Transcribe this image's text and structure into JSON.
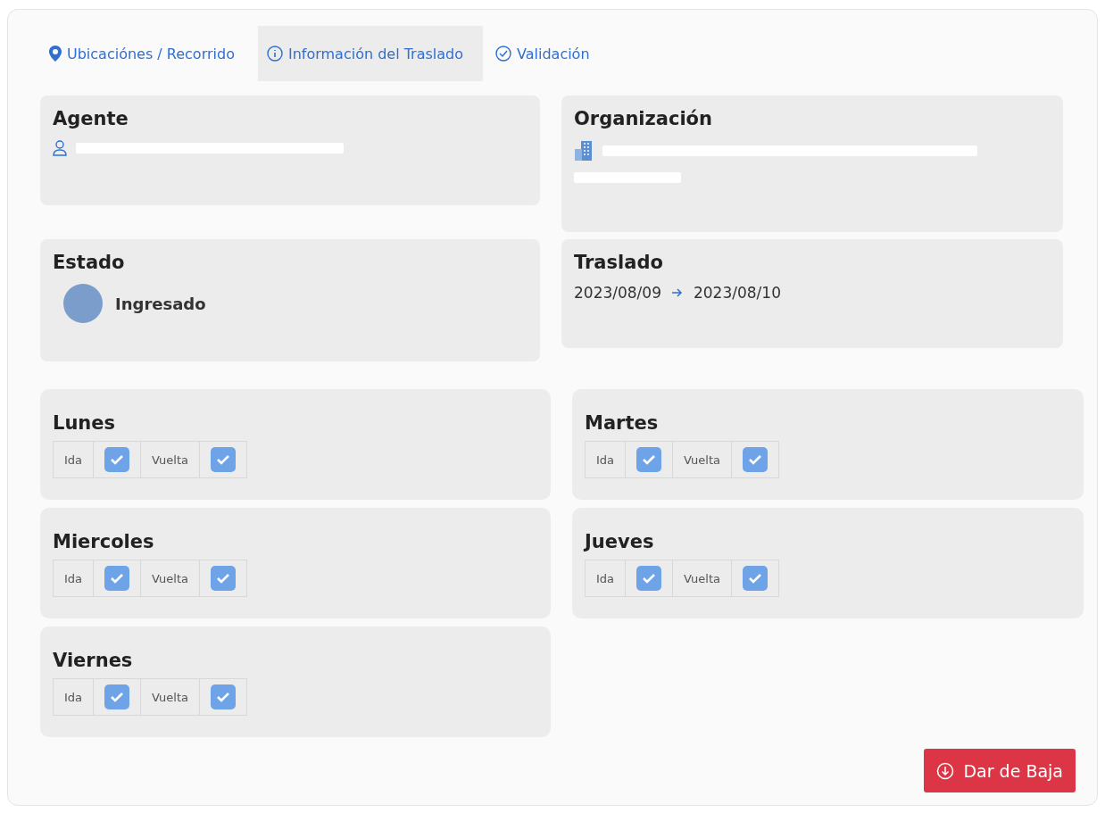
{
  "tabs": [
    {
      "label": "Ubicaciónes / Recorrido",
      "kind": "pin",
      "selected": false
    },
    {
      "label": "Información del Traslado",
      "kind": "info",
      "selected": true
    },
    {
      "label": "Validación",
      "kind": "check",
      "selected": false
    }
  ],
  "agente": {
    "title": "Agente"
  },
  "organizacion": {
    "title": "Organización"
  },
  "estado": {
    "title": "Estado",
    "value": "Ingresado",
    "color": "#7b9dcb"
  },
  "traslado": {
    "title": "Traslado",
    "from": "2023/08/09",
    "to": "2023/08/10"
  },
  "days": [
    {
      "name": "Lunes",
      "ida_label": "Ida",
      "ida": true,
      "vuelta_label": "Vuelta",
      "vuelta": true
    },
    {
      "name": "Martes",
      "ida_label": "Ida",
      "ida": true,
      "vuelta_label": "Vuelta",
      "vuelta": true
    },
    {
      "name": "Miercoles",
      "ida_label": "Ida",
      "ida": true,
      "vuelta_label": "Vuelta",
      "vuelta": true
    },
    {
      "name": "Jueves",
      "ida_label": "Ida",
      "ida": true,
      "vuelta_label": "Vuelta",
      "vuelta": true
    },
    {
      "name": "Viernes",
      "ida_label": "Ida",
      "ida": true,
      "vuelta_label": "Vuelta",
      "vuelta": true
    }
  ],
  "button": {
    "label": "Dar de Baja"
  }
}
